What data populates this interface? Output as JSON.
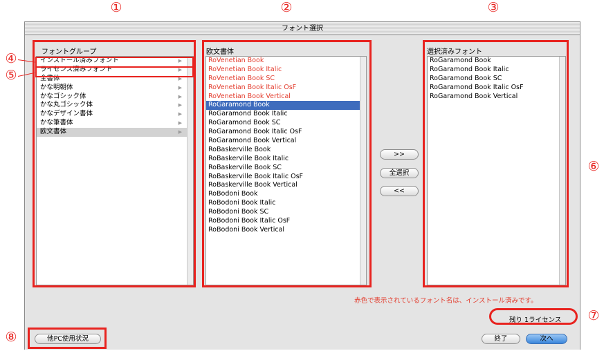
{
  "callouts": [
    "①",
    "②",
    "③",
    "④",
    "⑤",
    "⑥",
    "⑦",
    "⑧"
  ],
  "window": {
    "title": "フォント選択"
  },
  "font_group": {
    "header": "フォントグループ",
    "items": [
      "インストール済みフォント",
      "ライセンス済みフォント",
      "全書体",
      "かな明朝体",
      "かなゴシック体",
      "かな丸ゴシック体",
      "かなデザイン書体",
      "かな筆書体",
      "欧文書体"
    ],
    "selected": "欧文書体"
  },
  "font_list": {
    "header": "欧文書体",
    "items": [
      {
        "name": "RoVenetian Book",
        "installed": true
      },
      {
        "name": "RoVenetian Book Italic",
        "installed": true
      },
      {
        "name": "RoVenetian Book SC",
        "installed": true
      },
      {
        "name": "RoVenetian Book Italic OsF",
        "installed": true
      },
      {
        "name": "RoVenetian Book Vertical",
        "installed": true
      },
      {
        "name": "RoGaramond Book",
        "installed": false,
        "selected": true
      },
      {
        "name": "RoGaramond Book Italic",
        "installed": false
      },
      {
        "name": "RoGaramond Book SC",
        "installed": false
      },
      {
        "name": "RoGaramond Book Italic OsF",
        "installed": false
      },
      {
        "name": "RoGaramond Book Vertical",
        "installed": false
      },
      {
        "name": "RoBaskerville Book",
        "installed": false
      },
      {
        "name": "RoBaskerville Book Italic",
        "installed": false
      },
      {
        "name": "RoBaskerville Book SC",
        "installed": false
      },
      {
        "name": "RoBaskerville Book Italic OsF",
        "installed": false
      },
      {
        "name": "RoBaskerville Book Vertical",
        "installed": false
      },
      {
        "name": "RoBodoni Book",
        "installed": false
      },
      {
        "name": "RoBodoni Book Italic",
        "installed": false
      },
      {
        "name": "RoBodoni Book SC",
        "installed": false
      },
      {
        "name": "RoBodoni Book Italic OsF",
        "installed": false
      },
      {
        "name": "RoBodoni Book Vertical",
        "installed": false
      }
    ]
  },
  "buttons": {
    "add": ">>",
    "select_all": "全選択",
    "remove": "<<",
    "other_pc": "他PC使用状況",
    "end": "終了",
    "next": "次へ"
  },
  "selected_fonts": {
    "header": "選択済みフォント",
    "items": [
      "RoGaramond Book",
      "RoGaramond Book Italic",
      "RoGaramond Book SC",
      "RoGaramond Book Italic OsF",
      "RoGaramond Book Vertical"
    ]
  },
  "note": "赤色で表示されているフォント名は、インストール済みです。",
  "license_remaining": "残り 1ライセンス",
  "colors": {
    "annotation_red": "#e8231f",
    "installed_red": "#e33b2c",
    "selection_blue": "#3e6cbd"
  }
}
